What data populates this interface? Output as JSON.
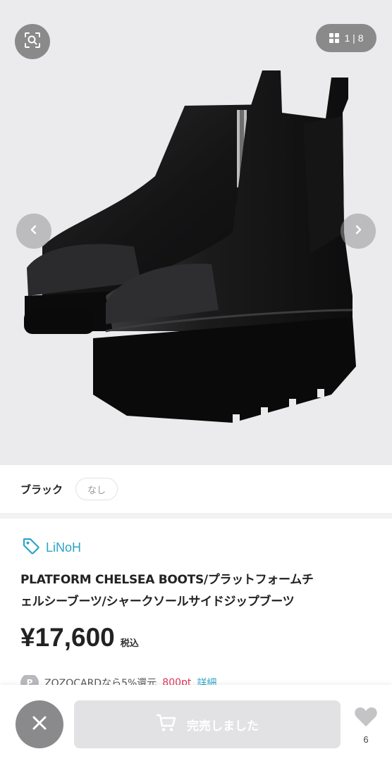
{
  "image_viewer": {
    "counter": "1 | 8",
    "icons": {
      "lens": "visual-search-icon",
      "grid": "grid-icon",
      "prev": "chevron-left-icon",
      "next": "chevron-right-icon"
    }
  },
  "variant": {
    "color": "ブラック",
    "size": "なし"
  },
  "product": {
    "brand": "LiNoH",
    "title_line1": "PLATFORM CHELSEA BOOTS/プラットフォームチ",
    "title_line2": "ェルシーブーツ/シャークソールサイドジップブーツ",
    "price": "¥17,600",
    "tax_label": "税込"
  },
  "promo": {
    "badge": "P",
    "text": "ZOZOCARDなら5%還元",
    "points": "800pt",
    "detail_link": "詳細"
  },
  "bottom_bar": {
    "sold_out_label": "完売しました",
    "favorite_count": "6"
  },
  "colors": {
    "brand_accent": "#2ca3c8",
    "points_red": "#e0325a",
    "disabled_button": "#e2e2e4"
  }
}
